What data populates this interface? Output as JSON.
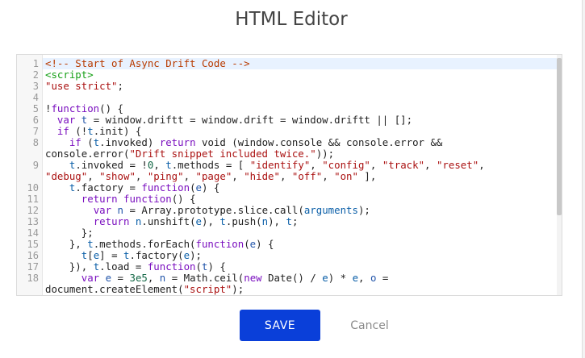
{
  "dialog": {
    "title": "HTML Editor",
    "save_label": "SAVE",
    "cancel_label": "Cancel"
  },
  "editor": {
    "line_numbers": [
      "1",
      "2",
      "3",
      "4",
      "5",
      "6",
      "7",
      "8",
      "",
      "9",
      "",
      "10",
      "11",
      "12",
      "13",
      "14",
      "15",
      "16",
      "17",
      "18",
      ""
    ],
    "lines": [
      [
        {
          "t": "<!-- Start of Async Drift Code -->",
          "c": "com"
        }
      ],
      [
        {
          "t": "<script>",
          "c": "tag"
        }
      ],
      [
        {
          "t": "\"use strict\"",
          "c": "str"
        },
        {
          "t": ";",
          "c": ""
        }
      ],
      [
        {
          "t": "",
          "c": ""
        }
      ],
      [
        {
          "t": "!",
          "c": ""
        },
        {
          "t": "function",
          "c": "kw"
        },
        {
          "t": "() {",
          "c": ""
        }
      ],
      [
        {
          "t": "  ",
          "c": ""
        },
        {
          "t": "var",
          "c": "kw"
        },
        {
          "t": " ",
          "c": ""
        },
        {
          "t": "t",
          "c": "def"
        },
        {
          "t": " = window.driftt = window.drift = window.driftt || [];",
          "c": ""
        }
      ],
      [
        {
          "t": "  ",
          "c": ""
        },
        {
          "t": "if",
          "c": "kw"
        },
        {
          "t": " (!",
          "c": ""
        },
        {
          "t": "t",
          "c": "var"
        },
        {
          "t": ".init) {",
          "c": ""
        }
      ],
      [
        {
          "t": "    ",
          "c": ""
        },
        {
          "t": "if",
          "c": "kw"
        },
        {
          "t": " (",
          "c": ""
        },
        {
          "t": "t",
          "c": "var"
        },
        {
          "t": ".invoked) ",
          "c": ""
        },
        {
          "t": "return",
          "c": "kw"
        },
        {
          "t": " void (window.console && console.error &&",
          "c": ""
        }
      ],
      [
        {
          "t": "console.error(",
          "c": ""
        },
        {
          "t": "\"Drift snippet included twice.\"",
          "c": "str"
        },
        {
          "t": "));",
          "c": ""
        }
      ],
      [
        {
          "t": "    ",
          "c": ""
        },
        {
          "t": "t",
          "c": "var"
        },
        {
          "t": ".invoked = !",
          "c": ""
        },
        {
          "t": "0",
          "c": "num"
        },
        {
          "t": ", ",
          "c": ""
        },
        {
          "t": "t",
          "c": "var"
        },
        {
          "t": ".methods = [ ",
          "c": ""
        },
        {
          "t": "\"identify\"",
          "c": "str"
        },
        {
          "t": ", ",
          "c": ""
        },
        {
          "t": "\"config\"",
          "c": "str"
        },
        {
          "t": ", ",
          "c": ""
        },
        {
          "t": "\"track\"",
          "c": "str"
        },
        {
          "t": ", ",
          "c": ""
        },
        {
          "t": "\"reset\"",
          "c": "str"
        },
        {
          "t": ",",
          "c": ""
        }
      ],
      [
        {
          "t": "\"debug\"",
          "c": "str"
        },
        {
          "t": ", ",
          "c": ""
        },
        {
          "t": "\"show\"",
          "c": "str"
        },
        {
          "t": ", ",
          "c": ""
        },
        {
          "t": "\"ping\"",
          "c": "str"
        },
        {
          "t": ", ",
          "c": ""
        },
        {
          "t": "\"page\"",
          "c": "str"
        },
        {
          "t": ", ",
          "c": ""
        },
        {
          "t": "\"hide\"",
          "c": "str"
        },
        {
          "t": ", ",
          "c": ""
        },
        {
          "t": "\"off\"",
          "c": "str"
        },
        {
          "t": ", ",
          "c": ""
        },
        {
          "t": "\"on\"",
          "c": "str"
        },
        {
          "t": " ],",
          "c": ""
        }
      ],
      [
        {
          "t": "    ",
          "c": ""
        },
        {
          "t": "t",
          "c": "var"
        },
        {
          "t": ".factory = ",
          "c": ""
        },
        {
          "t": "function",
          "c": "kw"
        },
        {
          "t": "(",
          "c": ""
        },
        {
          "t": "e",
          "c": "def"
        },
        {
          "t": ") {",
          "c": ""
        }
      ],
      [
        {
          "t": "      ",
          "c": ""
        },
        {
          "t": "return",
          "c": "kw"
        },
        {
          "t": " ",
          "c": ""
        },
        {
          "t": "function",
          "c": "kw"
        },
        {
          "t": "() {",
          "c": ""
        }
      ],
      [
        {
          "t": "        ",
          "c": ""
        },
        {
          "t": "var",
          "c": "kw"
        },
        {
          "t": " ",
          "c": ""
        },
        {
          "t": "n",
          "c": "def"
        },
        {
          "t": " = Array.prototype.slice.call(",
          "c": ""
        },
        {
          "t": "arguments",
          "c": "var"
        },
        {
          "t": ");",
          "c": ""
        }
      ],
      [
        {
          "t": "        ",
          "c": ""
        },
        {
          "t": "return",
          "c": "kw"
        },
        {
          "t": " ",
          "c": ""
        },
        {
          "t": "n",
          "c": "var"
        },
        {
          "t": ".unshift(",
          "c": ""
        },
        {
          "t": "e",
          "c": "var"
        },
        {
          "t": "), ",
          "c": ""
        },
        {
          "t": "t",
          "c": "var"
        },
        {
          "t": ".push(",
          "c": ""
        },
        {
          "t": "n",
          "c": "var"
        },
        {
          "t": "), ",
          "c": ""
        },
        {
          "t": "t",
          "c": "var"
        },
        {
          "t": ";",
          "c": ""
        }
      ],
      [
        {
          "t": "      };",
          "c": ""
        }
      ],
      [
        {
          "t": "    }, ",
          "c": ""
        },
        {
          "t": "t",
          "c": "var"
        },
        {
          "t": ".methods.forEach(",
          "c": ""
        },
        {
          "t": "function",
          "c": "kw"
        },
        {
          "t": "(",
          "c": ""
        },
        {
          "t": "e",
          "c": "def"
        },
        {
          "t": ") {",
          "c": ""
        }
      ],
      [
        {
          "t": "      ",
          "c": ""
        },
        {
          "t": "t",
          "c": "var"
        },
        {
          "t": "[",
          "c": ""
        },
        {
          "t": "e",
          "c": "var"
        },
        {
          "t": "] = ",
          "c": ""
        },
        {
          "t": "t",
          "c": "var"
        },
        {
          "t": ".factory(",
          "c": ""
        },
        {
          "t": "e",
          "c": "var"
        },
        {
          "t": ");",
          "c": ""
        }
      ],
      [
        {
          "t": "    }), ",
          "c": ""
        },
        {
          "t": "t",
          "c": "var"
        },
        {
          "t": ".load = ",
          "c": ""
        },
        {
          "t": "function",
          "c": "kw"
        },
        {
          "t": "(",
          "c": ""
        },
        {
          "t": "t",
          "c": "def"
        },
        {
          "t": ") {",
          "c": ""
        }
      ],
      [
        {
          "t": "      ",
          "c": ""
        },
        {
          "t": "var",
          "c": "kw"
        },
        {
          "t": " ",
          "c": ""
        },
        {
          "t": "e",
          "c": "def"
        },
        {
          "t": " = ",
          "c": ""
        },
        {
          "t": "3e5",
          "c": "num"
        },
        {
          "t": ", ",
          "c": ""
        },
        {
          "t": "n",
          "c": "def"
        },
        {
          "t": " = Math.ceil(",
          "c": ""
        },
        {
          "t": "new",
          "c": "kw"
        },
        {
          "t": " Date() / ",
          "c": ""
        },
        {
          "t": "e",
          "c": "var"
        },
        {
          "t": ") * ",
          "c": ""
        },
        {
          "t": "e",
          "c": "var"
        },
        {
          "t": ", ",
          "c": ""
        },
        {
          "t": "o",
          "c": "def"
        },
        {
          "t": " =",
          "c": ""
        }
      ],
      [
        {
          "t": "document.createElement(",
          "c": ""
        },
        {
          "t": "\"script\"",
          "c": "str"
        },
        {
          "t": ");",
          "c": ""
        }
      ]
    ]
  }
}
